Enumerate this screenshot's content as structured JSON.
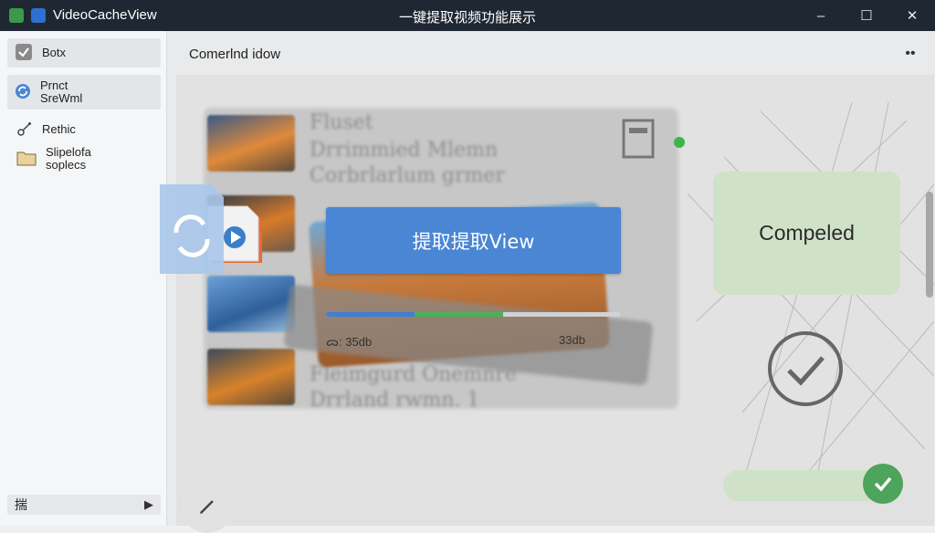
{
  "window": {
    "app_name": "VideoCacheView",
    "title": "一键提取视频功能展示",
    "controls": {
      "minimize": "–",
      "maximize": "☐",
      "close": "✕"
    }
  },
  "sidebar": {
    "items": [
      {
        "label": "Botx",
        "icon": "check-box-icon",
        "selected": true
      },
      {
        "label": "Prnct\nSreWml",
        "icon": "sync-circle-icon",
        "selected": true
      },
      {
        "label": "Rethic",
        "icon": "link-icon",
        "selected": false
      },
      {
        "label": "Slipelofa\nsoplecs",
        "icon": "folder-icon",
        "selected": false
      }
    ],
    "footer": {
      "label": "揣",
      "arrow": "▶"
    }
  },
  "main": {
    "header_title": "Comerlnd idow",
    "more": "••",
    "action_button": "提取提取View",
    "progress": {
      "blue_fraction": 0.3,
      "green_fraction": 0.3
    },
    "meta_left": "ᯅ:  35db",
    "meta_right": "33db",
    "status_card": "Compeled",
    "blurred_texts": [
      "Fluset",
      "Drrimmied Mlemn",
      "Corbrlarlum grmer",
      "Fleimgurd Onemnre",
      "Drrland rwmn. 1"
    ]
  },
  "colors": {
    "titlebar": "#1f2733",
    "accent_blue": "#4a86d4",
    "success_green": "#4ea45a",
    "card_green": "#cfe2c8"
  }
}
